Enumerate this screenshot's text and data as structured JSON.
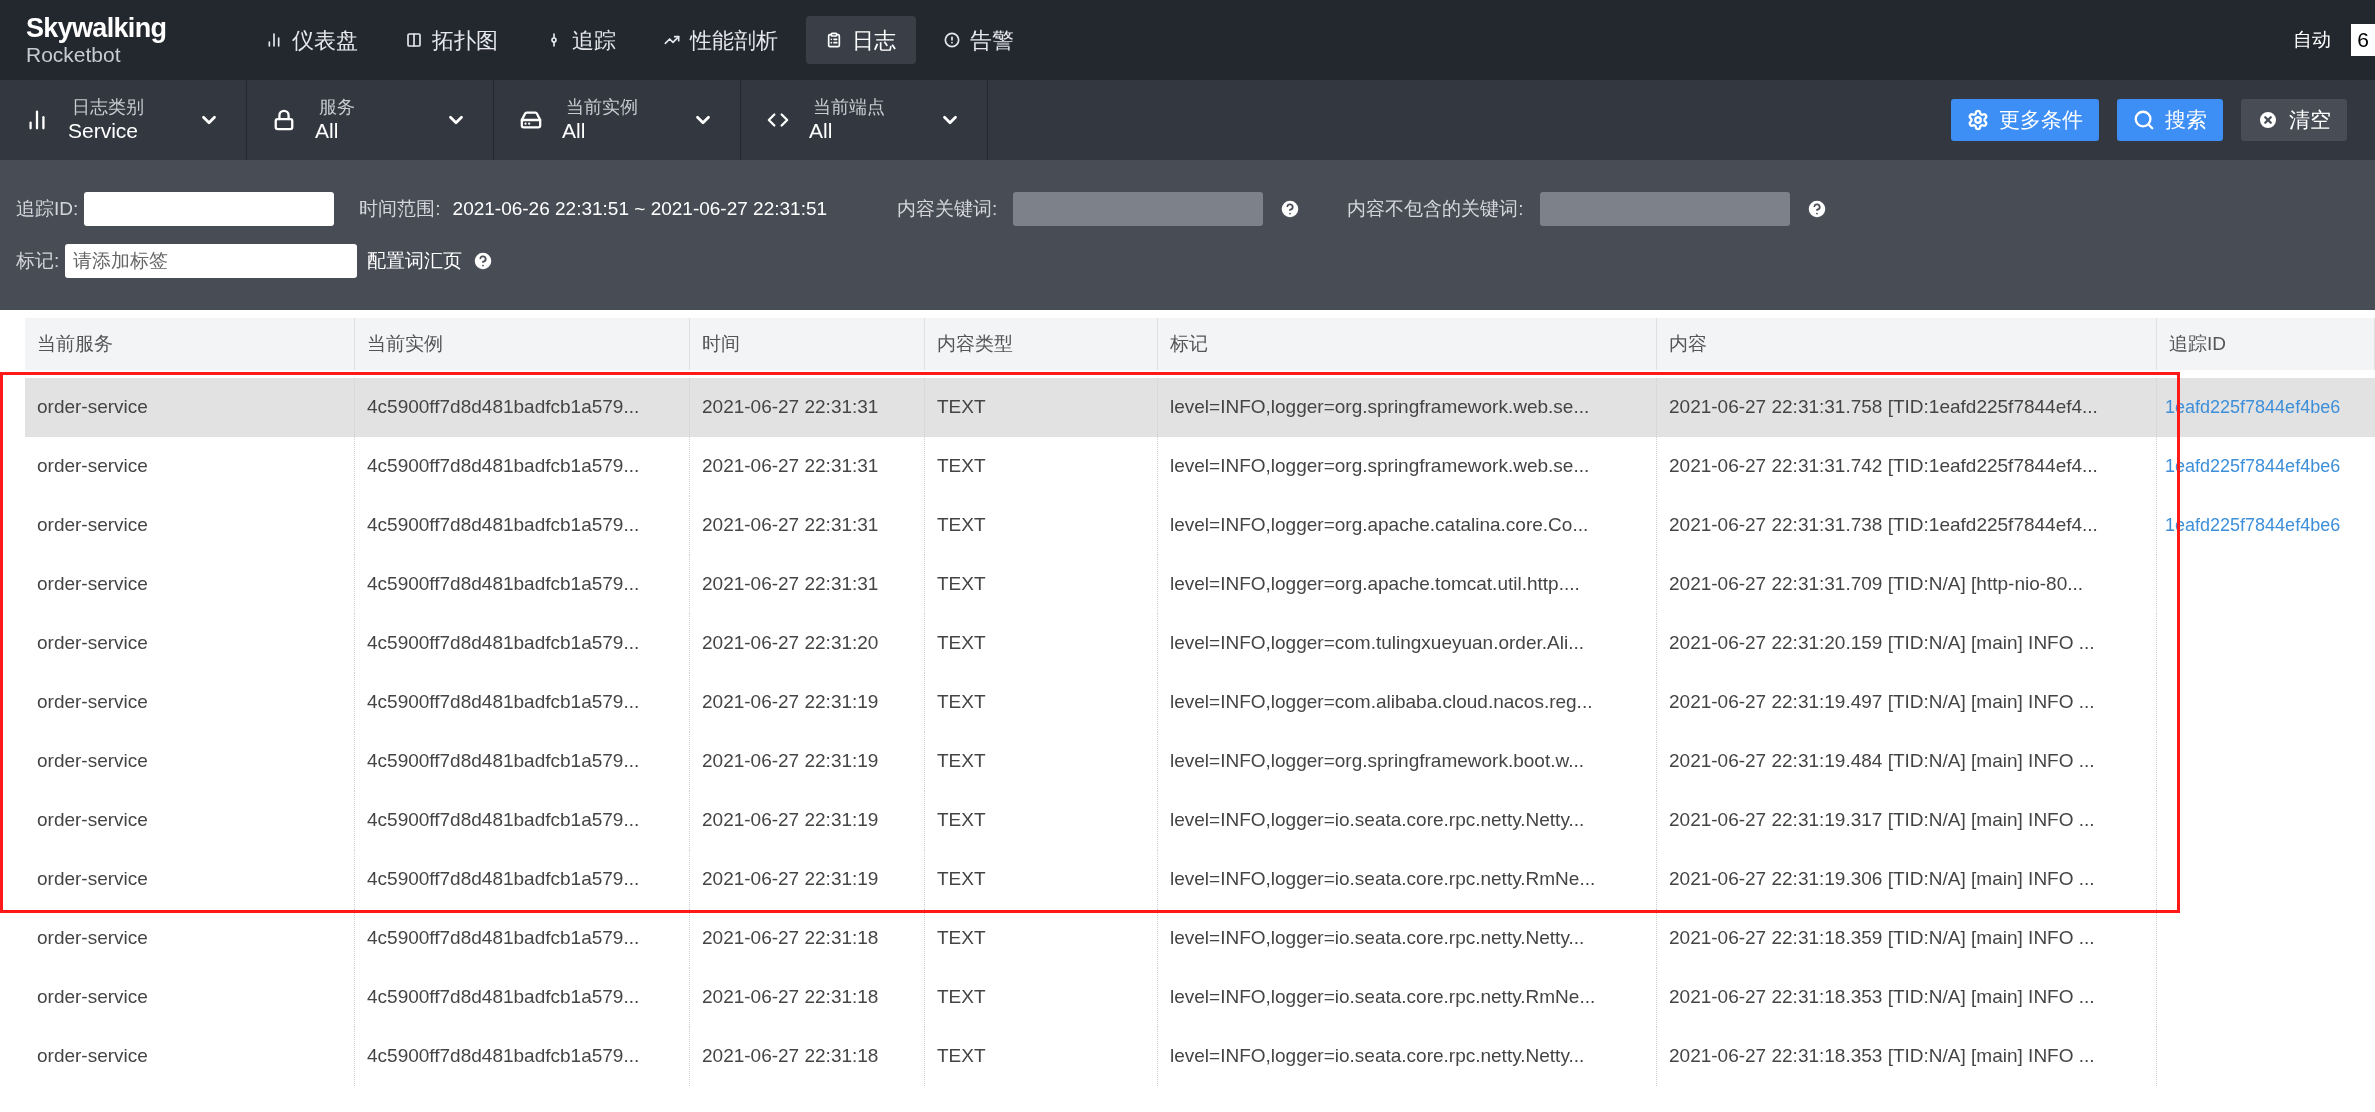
{
  "logo": {
    "title": "Skywalking",
    "subtitle": "Rocketbot"
  },
  "nav": [
    {
      "label": "仪表盘",
      "selected": false
    },
    {
      "label": "拓扑图",
      "selected": false
    },
    {
      "label": "追踪",
      "selected": false
    },
    {
      "label": "性能剖析",
      "selected": false
    },
    {
      "label": "日志",
      "selected": true
    },
    {
      "label": "告警",
      "selected": false
    }
  ],
  "auto_refresh": {
    "label": "自动",
    "value": "6"
  },
  "selectors": [
    {
      "label": "日志类别",
      "value": "Service"
    },
    {
      "label": "服务",
      "value": "All"
    },
    {
      "label": "当前实例",
      "value": "All"
    },
    {
      "label": "当前端点",
      "value": "All"
    }
  ],
  "actions": [
    {
      "label": "更多条件",
      "kind": "primary"
    },
    {
      "label": "搜索",
      "kind": "primary"
    },
    {
      "label": "清空",
      "kind": "secondary"
    }
  ],
  "conditions": {
    "trace_id": {
      "label": "追踪ID:"
    },
    "time_range": {
      "label": "时间范围:",
      "value": "2021-06-26 22:31:51 ~ 2021-06-27 22:31:51"
    },
    "keywords": {
      "label": "内容关键词:",
      "disabled": true
    },
    "exclude_keywords": {
      "label": "内容不包含的关键词:",
      "disabled": true
    },
    "tags": {
      "label": "标记:",
      "placeholder": "请添加标签"
    },
    "vocabulary": {
      "label": "配置词汇页"
    }
  },
  "table": {
    "columns": [
      "当前服务",
      "当前实例",
      "时间",
      "内容类型",
      "标记",
      "内容",
      "追踪ID"
    ],
    "highlighted_rows": [
      {
        "service": "order-service",
        "instance": "4c5900ff7d8d481badfcb1a579...",
        "time": "2021-06-27 22:31:31",
        "type": "TEXT",
        "tags": "level=INFO,logger=org.springframework.web.se...",
        "content": "2021-06-27 22:31:31.758 [TID:1eafd225f7844ef4...",
        "trace_id": "1eafd225f7844ef4be6",
        "hovered": true
      },
      {
        "service": "order-service",
        "instance": "4c5900ff7d8d481badfcb1a579...",
        "time": "2021-06-27 22:31:31",
        "type": "TEXT",
        "tags": "level=INFO,logger=org.springframework.web.se...",
        "content": "2021-06-27 22:31:31.742 [TID:1eafd225f7844ef4...",
        "trace_id": "1eafd225f7844ef4be6",
        "hovered": false
      },
      {
        "service": "order-service",
        "instance": "4c5900ff7d8d481badfcb1a579...",
        "time": "2021-06-27 22:31:31",
        "type": "TEXT",
        "tags": "level=INFO,logger=org.apache.catalina.core.Co...",
        "content": "2021-06-27 22:31:31.738 [TID:1eafd225f7844ef4...",
        "trace_id": "1eafd225f7844ef4be6",
        "hovered": false
      },
      {
        "service": "order-service",
        "instance": "4c5900ff7d8d481badfcb1a579...",
        "time": "2021-06-27 22:31:31",
        "type": "TEXT",
        "tags": "level=INFO,logger=org.apache.tomcat.util.http....",
        "content": "2021-06-27 22:31:31.709 [TID:N/A] [http-nio-80...",
        "hovered": false
      },
      {
        "service": "order-service",
        "instance": "4c5900ff7d8d481badfcb1a579...",
        "time": "2021-06-27 22:31:20",
        "type": "TEXT",
        "tags": "level=INFO,logger=com.tulingxueyuan.order.Ali...",
        "content": "2021-06-27 22:31:20.159 [TID:N/A] [main] INFO ...",
        "hovered": false
      },
      {
        "service": "order-service",
        "instance": "4c5900ff7d8d481badfcb1a579...",
        "time": "2021-06-27 22:31:19",
        "type": "TEXT",
        "tags": "level=INFO,logger=com.alibaba.cloud.nacos.reg...",
        "content": "2021-06-27 22:31:19.497 [TID:N/A] [main] INFO ...",
        "hovered": false
      },
      {
        "service": "order-service",
        "instance": "4c5900ff7d8d481badfcb1a579...",
        "time": "2021-06-27 22:31:19",
        "type": "TEXT",
        "tags": "level=INFO,logger=org.springframework.boot.w...",
        "content": "2021-06-27 22:31:19.484 [TID:N/A] [main] INFO ...",
        "hovered": false
      },
      {
        "service": "order-service",
        "instance": "4c5900ff7d8d481badfcb1a579...",
        "time": "2021-06-27 22:31:19",
        "type": "TEXT",
        "tags": "level=INFO,logger=io.seata.core.rpc.netty.Netty...",
        "content": "2021-06-27 22:31:19.317 [TID:N/A] [main] INFO ...",
        "hovered": false
      },
      {
        "service": "order-service",
        "instance": "4c5900ff7d8d481badfcb1a579...",
        "time": "2021-06-27 22:31:19",
        "type": "TEXT",
        "tags": "level=INFO,logger=io.seata.core.rpc.netty.RmNe...",
        "content": "2021-06-27 22:31:19.306 [TID:N/A] [main] INFO ...",
        "hovered": false
      }
    ],
    "rows": [
      {
        "service": "order-service",
        "instance": "4c5900ff7d8d481badfcb1a579...",
        "time": "2021-06-27 22:31:18",
        "type": "TEXT",
        "tags": "level=INFO,logger=io.seata.core.rpc.netty.Netty...",
        "content": "2021-06-27 22:31:18.359 [TID:N/A] [main] INFO ...",
        "hovered": false
      },
      {
        "service": "order-service",
        "instance": "4c5900ff7d8d481badfcb1a579...",
        "time": "2021-06-27 22:31:18",
        "type": "TEXT",
        "tags": "level=INFO,logger=io.seata.core.rpc.netty.RmNe...",
        "content": "2021-06-27 22:31:18.353 [TID:N/A] [main] INFO ...",
        "hovered": false
      },
      {
        "service": "order-service",
        "instance": "4c5900ff7d8d481badfcb1a579...",
        "time": "2021-06-27 22:31:18",
        "type": "TEXT",
        "tags": "level=INFO,logger=io.seata.core.rpc.netty.Netty...",
        "content": "2021-06-27 22:31:18.353 [TID:N/A] [main] INFO ...",
        "hovered": false
      }
    ]
  }
}
